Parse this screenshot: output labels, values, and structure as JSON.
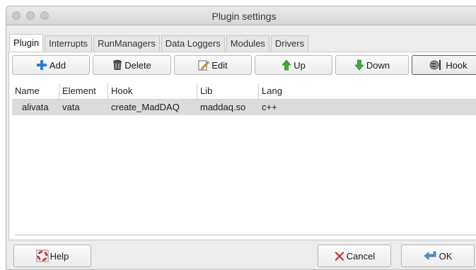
{
  "window": {
    "title": "Plugin settings"
  },
  "tabs": [
    {
      "label": "Plugin",
      "active": true
    },
    {
      "label": "Interrupts"
    },
    {
      "label": "RunManagers"
    },
    {
      "label": "Data Loggers"
    },
    {
      "label": "Modules"
    },
    {
      "label": "Drivers"
    }
  ],
  "toolbar": {
    "add": {
      "label": "Add",
      "icon": "plus-icon"
    },
    "delete": {
      "label": "Delete",
      "icon": "trash-icon"
    },
    "edit": {
      "label": "Edit",
      "icon": "pencil-icon"
    },
    "up": {
      "label": "Up",
      "icon": "arrow-up-icon"
    },
    "down": {
      "label": "Down",
      "icon": "arrow-down-icon"
    },
    "hook": {
      "label": "Hook",
      "icon": "hook-plug-icon"
    }
  },
  "table": {
    "columns": [
      "Name",
      "Element",
      "Hook",
      "Lib",
      "Lang"
    ],
    "rows": [
      {
        "name": "alivata",
        "element": "vata",
        "hook": "create_MadDAQ",
        "lib": "maddaq.so",
        "lang": "c++"
      }
    ]
  },
  "footer": {
    "help": {
      "label": "Help",
      "icon": "lifebuoy-icon"
    },
    "cancel": {
      "label": "Cancel",
      "icon": "red-x-icon"
    },
    "ok": {
      "label": "OK",
      "icon": "return-arrow-icon"
    }
  },
  "colors": {
    "add_icon": "#2f7bd8",
    "delete_icon": "#3a3a3a",
    "up_icon": "#3cae3c",
    "down_icon": "#3cae3c",
    "cancel_icon": "#d02a2a",
    "help_icon": "#d43838"
  }
}
